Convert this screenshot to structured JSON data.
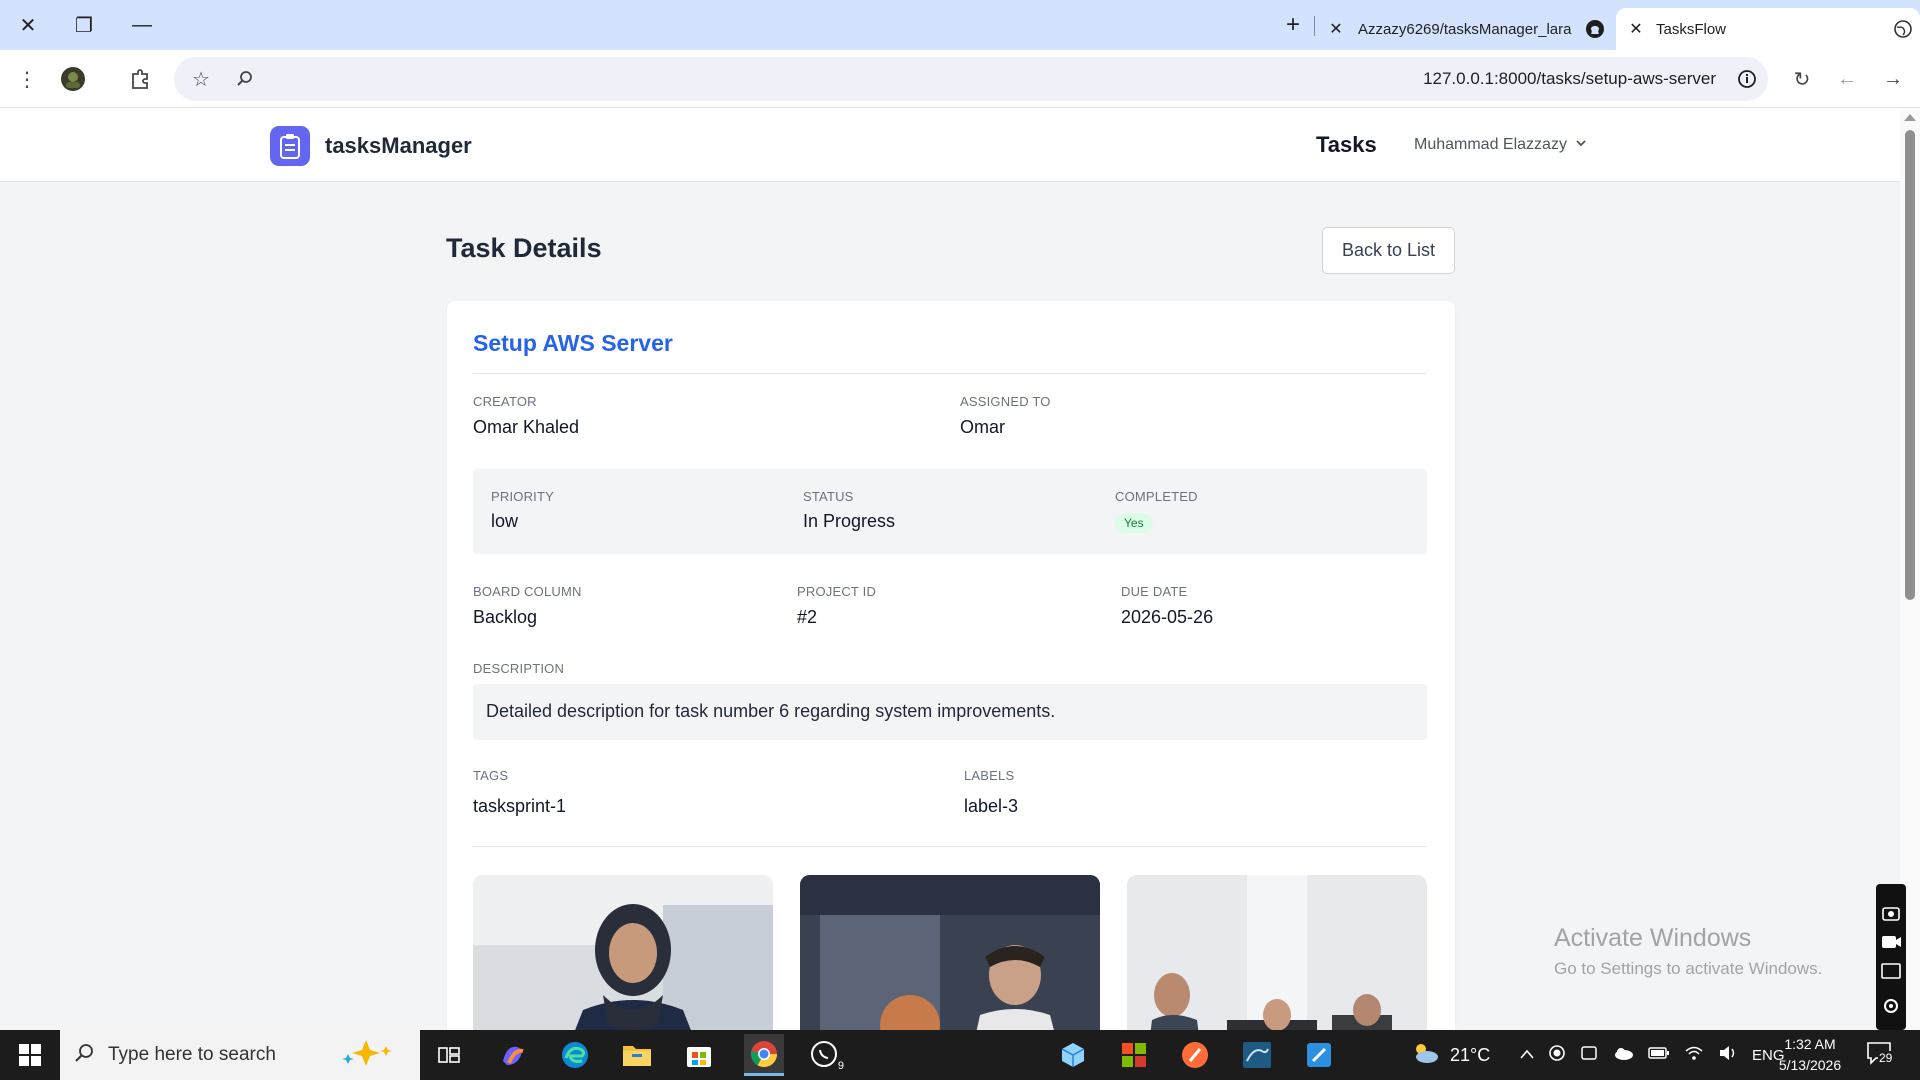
{
  "browser": {
    "tabs": [
      {
        "title": "Azzazy6269/tasksManager_lara",
        "active": false
      },
      {
        "title": "TasksFlow",
        "active": true
      }
    ],
    "url": "127.0.0.1:8000/tasks/setup-aws-server"
  },
  "header": {
    "brand": "tasksManager",
    "nav_tasks": "Tasks",
    "user_name": "Muhammad Elazzazy"
  },
  "page": {
    "title": "Task Details",
    "back_button": "Back to List"
  },
  "task": {
    "name": "Setup AWS Server",
    "creator_label": "CREATOR",
    "creator": "Omar Khaled",
    "assigned_label": "ASSIGNED TO",
    "assigned": "Omar",
    "priority_label": "PRIORITY",
    "priority": "low",
    "status_label": "STATUS",
    "status": "In Progress",
    "completed_label": "COMPLETED",
    "completed": "Yes",
    "board_label": "BOARD COLUMN",
    "board": "Backlog",
    "project_label": "PROJECT ID",
    "project": "#2",
    "due_label": "DUE DATE",
    "due": "2026-05-26",
    "description_label": "DESCRIPTION",
    "description": "Detailed description for task number 6 regarding system improvements.",
    "tags_label": "TAGS",
    "tags": "tasksprint-1",
    "labels_label": "LABELS",
    "labels": "label-3"
  },
  "watermark": {
    "line1": "Activate Windows",
    "line2": "Go to Settings to activate Windows."
  },
  "taskbar": {
    "search_placeholder": "Type here to search",
    "temperature": "21°C",
    "language": "ENG",
    "time": "1:32 AM",
    "date": "5/13/2026",
    "notification_count": "29",
    "whatsapp_badge": "9"
  }
}
